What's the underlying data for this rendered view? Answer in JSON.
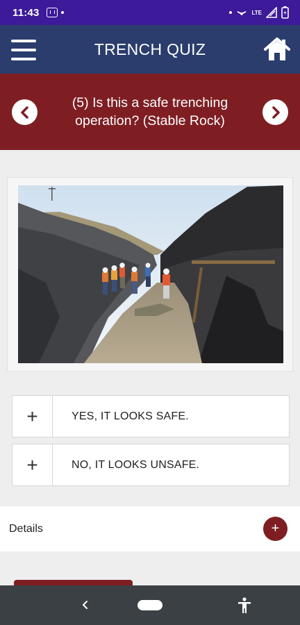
{
  "status_bar": {
    "time": "11:43",
    "network": "LTE",
    "icons": [
      "sim-icon",
      "notification-dot-icon",
      "hotspot-icon",
      "signal-icon",
      "battery-icon"
    ]
  },
  "header": {
    "title": "TRENCH QUIZ",
    "icons": [
      "menu-icon",
      "home-icon"
    ]
  },
  "question": {
    "text": "(5) Is this a safe trenching operation? (Stable Rock)",
    "prev_icon": "chevron-left-icon",
    "next_icon": "chevron-right-icon"
  },
  "answers": [
    {
      "symbol": "+",
      "label": "YES, IT LOOKS SAFE."
    },
    {
      "symbol": "+",
      "label": "NO, IT LOOKS UNSAFE."
    }
  ],
  "details": {
    "label": "Details",
    "button_symbol": "+"
  },
  "colors": {
    "status_bar": "#3c1a99",
    "app_bar": "#2b3d6d",
    "accent": "#7e1e23",
    "background": "#eeeeee",
    "nav_bar": "#3a4044"
  }
}
